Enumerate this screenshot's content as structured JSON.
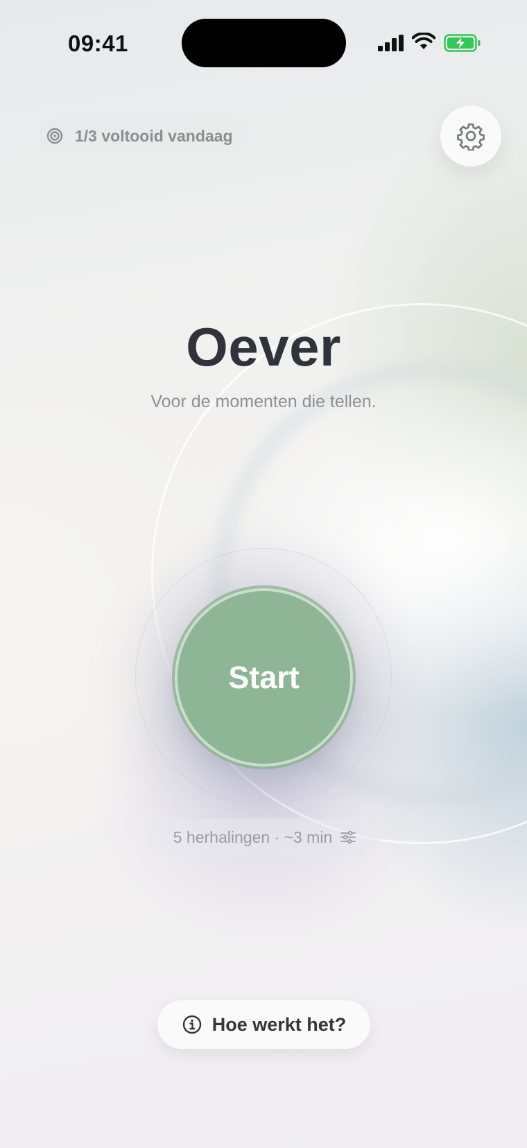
{
  "status_bar": {
    "time": "09:41"
  },
  "progress": {
    "label": "1/3 voltooid vandaag"
  },
  "title": "Oever",
  "subtitle": "Voor de momenten die tellen.",
  "start": {
    "label": "Start"
  },
  "session": {
    "label": "5 herhalingen · ~3 min"
  },
  "help": {
    "label": "Hoe werkt het?"
  },
  "colors": {
    "accent": "#8fb597",
    "title": "#30343a",
    "battery": "#34c759"
  }
}
